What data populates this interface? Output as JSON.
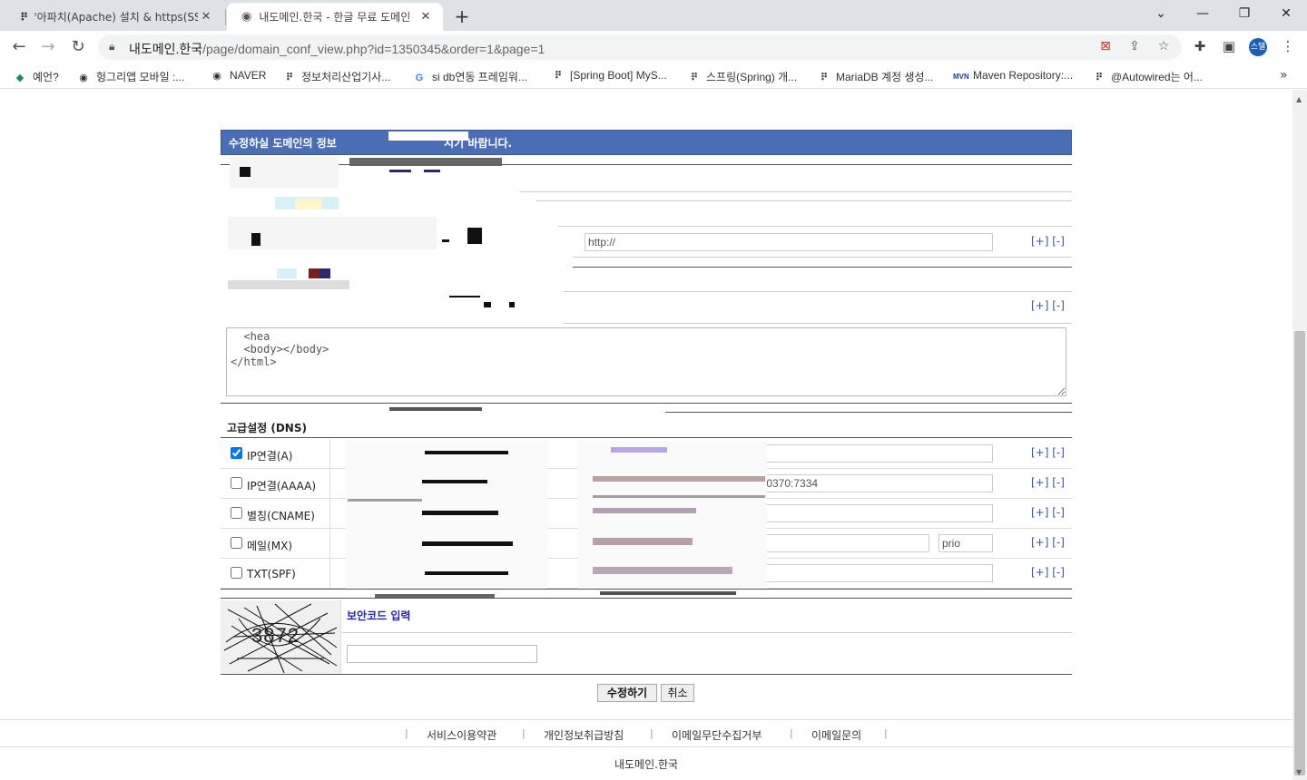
{
  "browser": {
    "tabs": [
      {
        "title": "'아파치(Apache) 설치 & https(SS",
        "active": false
      },
      {
        "title": "내도메인.한국 - 한글 무료 도메인",
        "active": true
      }
    ],
    "new_tab": "+",
    "window_controls": {
      "dropdown": "⌄",
      "minimize": "—",
      "restore": "❐",
      "close": "✕"
    },
    "url_host": "내도메인.한국",
    "url_path": "/page/domain_conf_view.php?id=1350345&order=1&page=1",
    "profile_label": "스텔",
    "bookmarks": [
      {
        "label": "예언?",
        "icon": "gem-icon"
      },
      {
        "label": "헝그리앱 모바일 :...",
        "icon": "globe-icon"
      },
      {
        "label": "NAVER",
        "icon": "globe-icon"
      },
      {
        "label": "정보처리산업기사...",
        "icon": "dots-icon"
      },
      {
        "label": "si db연동 프레임워...",
        "icon": "google-icon"
      },
      {
        "label": "[Spring Boot] MyS...",
        "icon": "dots-icon"
      },
      {
        "label": "스프링(Spring) 개...",
        "icon": "dots-icon"
      },
      {
        "label": "MariaDB 계정 생성...",
        "icon": "dots-icon"
      },
      {
        "label": "Maven Repository:...",
        "icon": "mvn-icon"
      },
      {
        "label": "@Autowired는 어...",
        "icon": "dots-icon"
      }
    ],
    "bookmarks_more": "»"
  },
  "form": {
    "header": "수정하실 도메인의 정보",
    "header_tail": "시기 바랍니다.",
    "redirect_placeholder": "http://",
    "plus_minus": "[+] [-]",
    "html_source": "  <hea\n  <body></body>\n</html>",
    "dns_title": "고급설정 (DNS)",
    "dns_rows": [
      {
        "label": "IP연결(A)",
        "checked": true,
        "value": ""
      },
      {
        "label": "IP연결(AAAA)",
        "checked": false,
        "value": ":0370:7334"
      },
      {
        "label": "별칭(CNAME)",
        "checked": false,
        "value": ""
      },
      {
        "label": "메일(MX)",
        "checked": false,
        "value": "",
        "prio": "prio"
      },
      {
        "label": "TXT(SPF)",
        "checked": false,
        "value": ""
      }
    ],
    "captcha_label": "보안코드 입력",
    "captcha_code": "3872",
    "submit_label": "수정하기",
    "cancel_label": "취소"
  },
  "footer": {
    "links": [
      "서비스이용약관",
      "개인정보취급방침",
      "이메일무단수집거부",
      "이메일문의"
    ],
    "brand": "내도메인.한국"
  },
  "colors": {
    "header_blue": "#4a6db5",
    "captcha_label": "#2222bb",
    "link_blue": "#3a55a0"
  }
}
